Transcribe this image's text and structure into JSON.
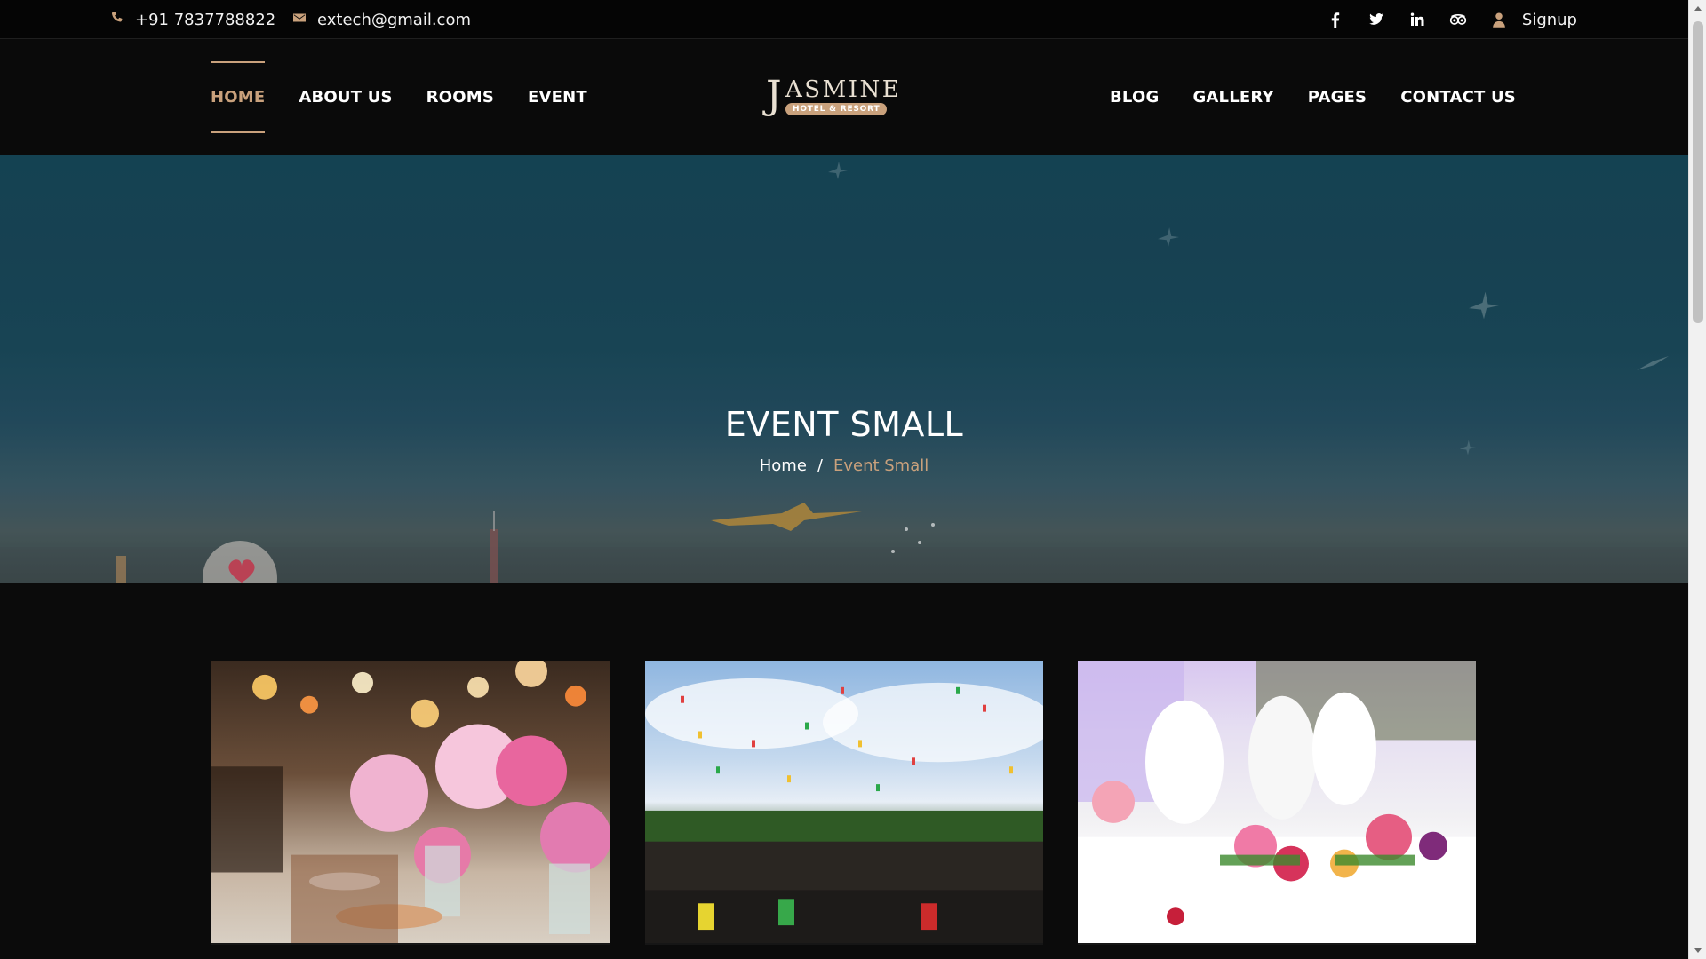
{
  "topbar": {
    "phone": "+91 7837788822",
    "email": "extech@gmail.com",
    "signup": "Signup",
    "icons": [
      "phone-icon",
      "email-icon",
      "facebook-icon",
      "twitter-icon",
      "linkedin-icon",
      "tripadvisor-icon",
      "user-icon"
    ]
  },
  "nav": {
    "left": [
      "HOME",
      "ABOUT US",
      "ROOMS",
      "EVENT"
    ],
    "right": [
      "BLOG",
      "GALLERY",
      "PAGES",
      "CONTACT US"
    ],
    "active": "HOME"
  },
  "logo": {
    "brand": "ASMINE",
    "initial": "J",
    "tagline": "HOTEL & RESORT"
  },
  "hero": {
    "title": "EVENT SMALL",
    "breadcrumb": {
      "home": "Home",
      "separator": "/",
      "current": "Event Small"
    }
  },
  "colors": {
    "accent": "#c9a17c",
    "background": "#0b0b0b",
    "topbar": "#050505",
    "hero_sky": "#1b4a5c"
  }
}
